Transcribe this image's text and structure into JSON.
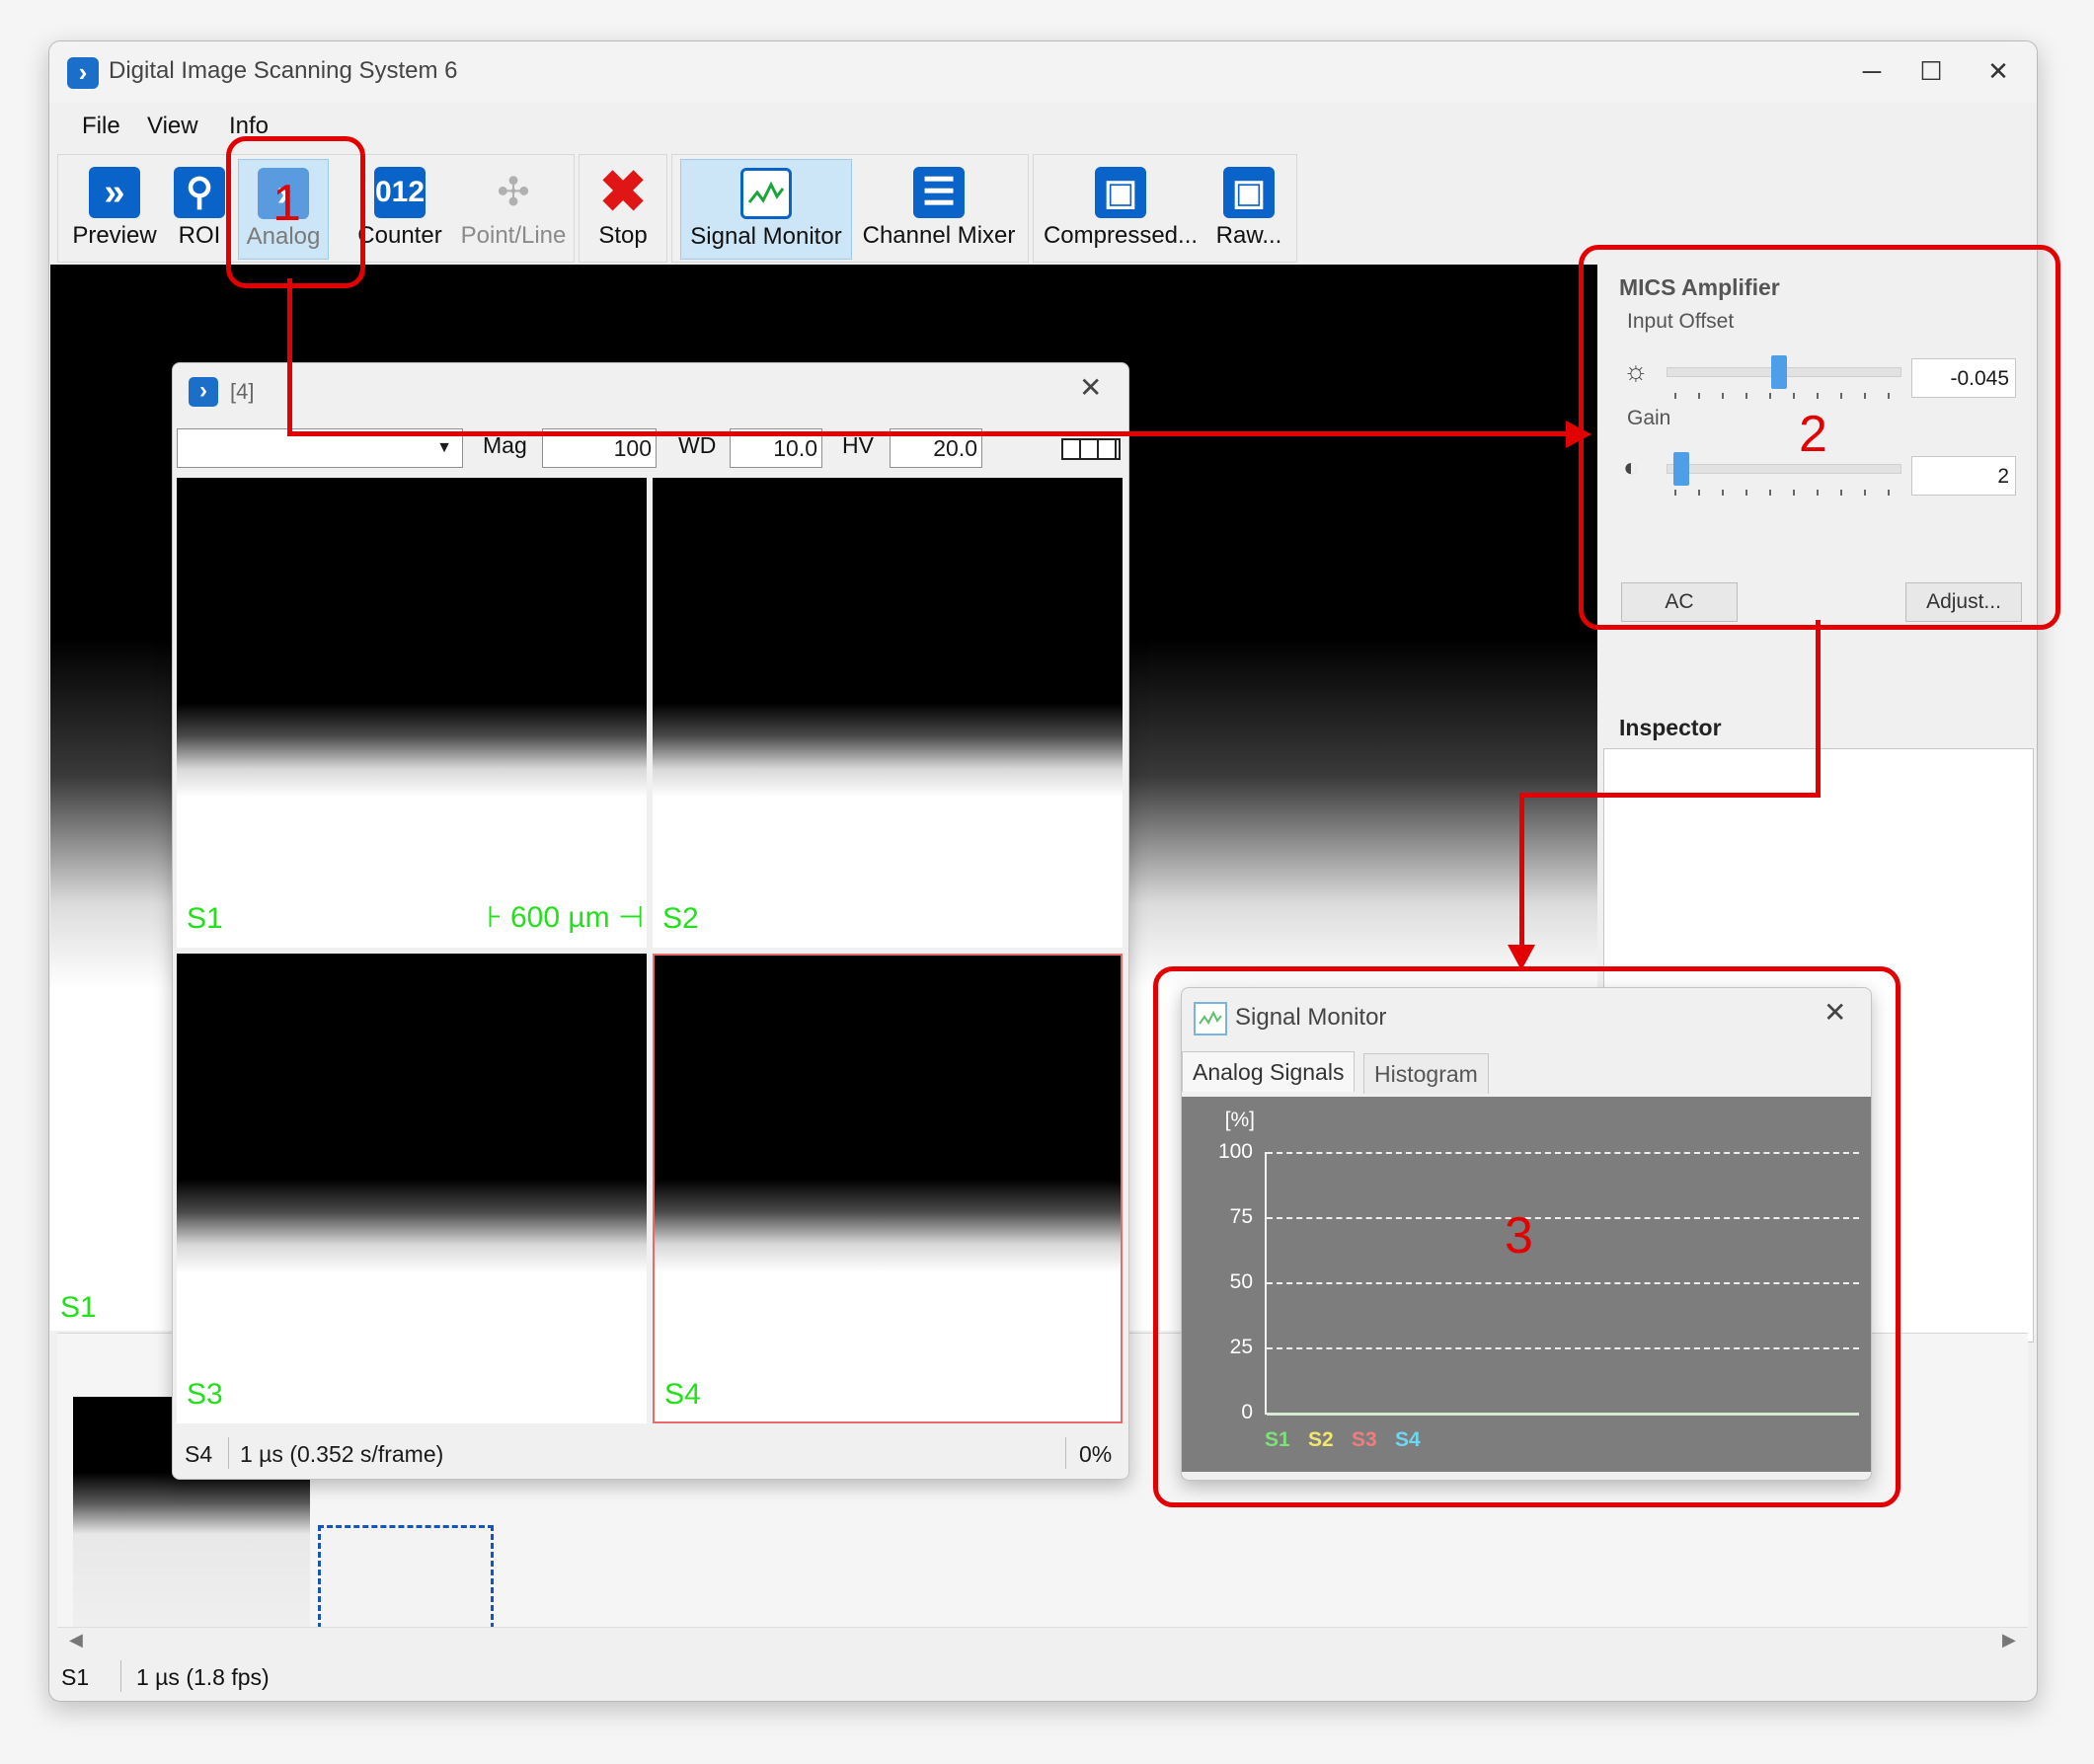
{
  "window": {
    "title": "Digital Image Scanning System 6",
    "minimize": "─",
    "maximize": "☐",
    "close": "✕"
  },
  "menu": [
    "File",
    "View",
    "Info"
  ],
  "toolbar": {
    "preview": "Preview",
    "roi": "ROI",
    "analog": "Analog",
    "counter": "Counter",
    "point_line": "Point/Line",
    "stop": "Stop",
    "signal_monitor": "Signal Monitor",
    "channel_mixer": "Channel Mixer",
    "compressed": "Compressed...",
    "raw": "Raw..."
  },
  "viewport": {
    "channel": "S1"
  },
  "mics": {
    "title": "MICS Amplifier",
    "input_offset_label": "Input Offset",
    "input_offset_value": "-0.045",
    "input_offset_level": 0.48,
    "gain_label": "Gain",
    "gain_value": "2",
    "gain_level": 0.03,
    "ac_button": "AC",
    "adjust_button": "Adjust..."
  },
  "inspector": {
    "title": "Inspector"
  },
  "quad_window": {
    "title": "[4]",
    "mag_label": "Mag",
    "mag_value": "100",
    "wd_label": "WD",
    "wd_value": "10.0",
    "hv_label": "HV",
    "hv_value": "20.0",
    "scale_bar": "⊦ 600 µm ⊣",
    "channels": [
      "S1",
      "S2",
      "S3",
      "S4"
    ],
    "status_channel": "S4",
    "status_timing": "1 µs (0.352 s/frame)",
    "status_progress": "0%"
  },
  "signal_monitor": {
    "title": "Signal Monitor",
    "tabs": [
      "Analog Signals",
      "Histogram"
    ],
    "y_unit": "[%]",
    "y_ticks": [
      "100",
      "75",
      "50",
      "25",
      "0"
    ],
    "legend": [
      {
        "name": "S1",
        "color": "#7ee07a"
      },
      {
        "name": "S2",
        "color": "#f2e76a"
      },
      {
        "name": "S3",
        "color": "#f07d7d"
      },
      {
        "name": "S4",
        "color": "#6fd6f2"
      }
    ]
  },
  "statusbar": {
    "channel": "S1",
    "timing": "1 µs (1.8 fps)"
  },
  "annotations": {
    "one": "1",
    "two": "2",
    "three": "3"
  }
}
